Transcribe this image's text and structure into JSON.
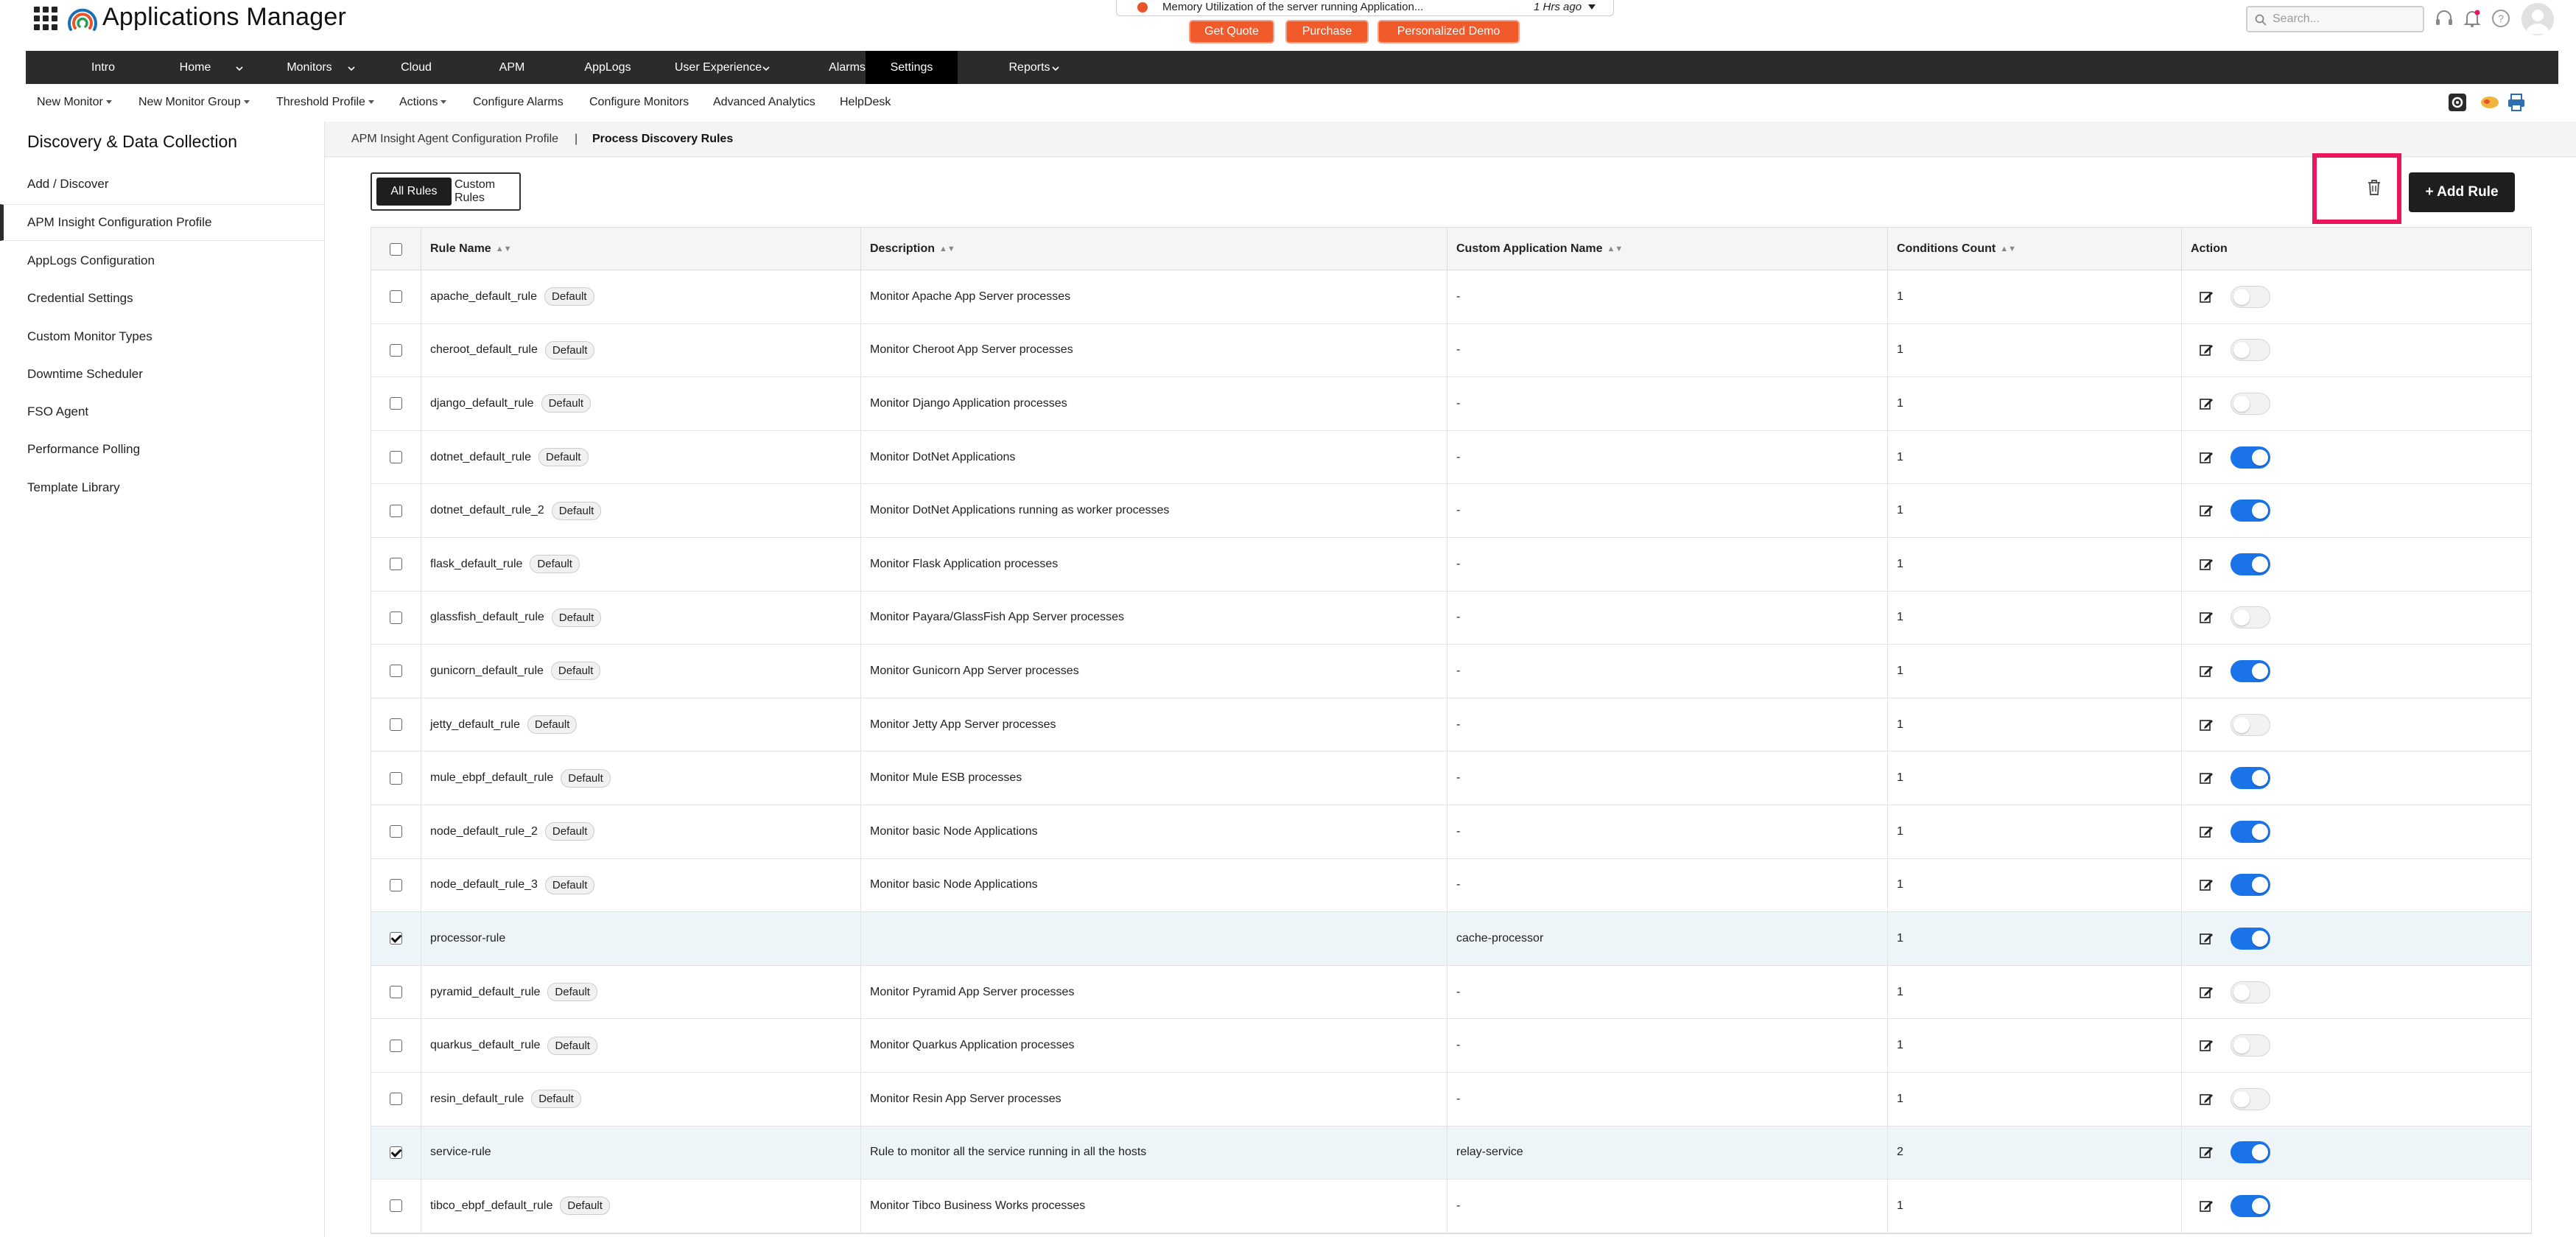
{
  "app": {
    "title": "Applications Manager"
  },
  "alert": {
    "text": "Memory Utilization of the server running Application...",
    "time": "1 Hrs ago"
  },
  "cta": {
    "get_quote": "Get Quote",
    "purchase": "Purchase",
    "demo": "Personalized Demo",
    "color": "#f15a2b"
  },
  "search": {
    "placeholder": "Search..."
  },
  "mainnav": {
    "items": [
      "Intro",
      "Home",
      "Monitors",
      "Cloud",
      "APM",
      "AppLogs",
      "User Experience",
      "Alarms",
      "Settings",
      "Reports"
    ],
    "active": "Settings"
  },
  "subnav": {
    "items": [
      "New Monitor",
      "New Monitor Group",
      "Threshold Profile",
      "Actions",
      "Configure Alarms",
      "Configure Monitors",
      "Advanced Analytics",
      "HelpDesk"
    ]
  },
  "sidebar": {
    "title": "Discovery & Data Collection",
    "items": [
      "Add / Discover",
      "APM Insight Configuration Profile",
      "AppLogs Configuration",
      "Credential Settings",
      "Custom Monitor Types",
      "Downtime Scheduler",
      "FSO Agent",
      "Performance Polling",
      "Template Library"
    ],
    "active": "APM Insight Configuration Profile"
  },
  "breadcrumb": {
    "parent": "APM Insight Agent Configuration Profile",
    "separator": "|",
    "current": "Process Discovery Rules"
  },
  "tabs": {
    "all": "All Rules",
    "custom": "Custom Rules",
    "active": "All Rules"
  },
  "toolbar": {
    "add_rule": "+ Add Rule",
    "delete_icon": "trash-icon",
    "highlight_color": "#e8175d"
  },
  "table": {
    "columns": [
      "Rule Name",
      "Description",
      "Custom Application Name",
      "Conditions Count",
      "Action"
    ],
    "default_badge": "Default",
    "toggle_on_color": "#1a73e8",
    "rows": [
      {
        "name": "apache_default_rule",
        "default": true,
        "description": "Monitor Apache App Server processes",
        "app": "-",
        "count": "1",
        "enabled": false,
        "checked": false
      },
      {
        "name": "cheroot_default_rule",
        "default": true,
        "description": "Monitor Cheroot App Server processes",
        "app": "-",
        "count": "1",
        "enabled": false,
        "checked": false
      },
      {
        "name": "django_default_rule",
        "default": true,
        "description": "Monitor Django Application processes",
        "app": "-",
        "count": "1",
        "enabled": false,
        "checked": false
      },
      {
        "name": "dotnet_default_rule",
        "default": true,
        "description": "Monitor DotNet Applications",
        "app": "-",
        "count": "1",
        "enabled": true,
        "checked": false
      },
      {
        "name": "dotnet_default_rule_2",
        "default": true,
        "description": "Monitor DotNet Applications running as worker processes",
        "app": "-",
        "count": "1",
        "enabled": true,
        "checked": false
      },
      {
        "name": "flask_default_rule",
        "default": true,
        "description": "Monitor Flask Application processes",
        "app": "-",
        "count": "1",
        "enabled": true,
        "checked": false
      },
      {
        "name": "glassfish_default_rule",
        "default": true,
        "description": "Monitor Payara/GlassFish App Server processes",
        "app": "-",
        "count": "1",
        "enabled": false,
        "checked": false
      },
      {
        "name": "gunicorn_default_rule",
        "default": true,
        "description": "Monitor Gunicorn App Server processes",
        "app": "-",
        "count": "1",
        "enabled": true,
        "checked": false
      },
      {
        "name": "jetty_default_rule",
        "default": true,
        "description": "Monitor Jetty App Server processes",
        "app": "-",
        "count": "1",
        "enabled": false,
        "checked": false
      },
      {
        "name": "mule_ebpf_default_rule",
        "default": true,
        "description": "Monitor Mule ESB processes",
        "app": "-",
        "count": "1",
        "enabled": true,
        "checked": false
      },
      {
        "name": "node_default_rule_2",
        "default": true,
        "description": "Monitor basic Node Applications",
        "app": "-",
        "count": "1",
        "enabled": true,
        "checked": false
      },
      {
        "name": "node_default_rule_3",
        "default": true,
        "description": "Monitor basic Node Applications",
        "app": "-",
        "count": "1",
        "enabled": true,
        "checked": false
      },
      {
        "name": "processor-rule",
        "default": false,
        "description": "",
        "app": "cache-processor",
        "count": "1",
        "enabled": true,
        "checked": true
      },
      {
        "name": "pyramid_default_rule",
        "default": true,
        "description": "Monitor Pyramid App Server processes",
        "app": "-",
        "count": "1",
        "enabled": false,
        "checked": false
      },
      {
        "name": "quarkus_default_rule",
        "default": true,
        "description": "Monitor Quarkus Application processes",
        "app": "-",
        "count": "1",
        "enabled": false,
        "checked": false
      },
      {
        "name": "resin_default_rule",
        "default": true,
        "description": "Monitor Resin App Server processes",
        "app": "-",
        "count": "1",
        "enabled": false,
        "checked": false
      },
      {
        "name": "service-rule",
        "default": false,
        "description": "Rule to monitor all the service running in all the hosts",
        "app": "relay-service",
        "count": "2",
        "enabled": true,
        "checked": true
      },
      {
        "name": "tibco_ebpf_default_rule",
        "default": true,
        "description": "Monitor Tibco Business Works processes",
        "app": "-",
        "count": "1",
        "enabled": true,
        "checked": false
      }
    ]
  }
}
